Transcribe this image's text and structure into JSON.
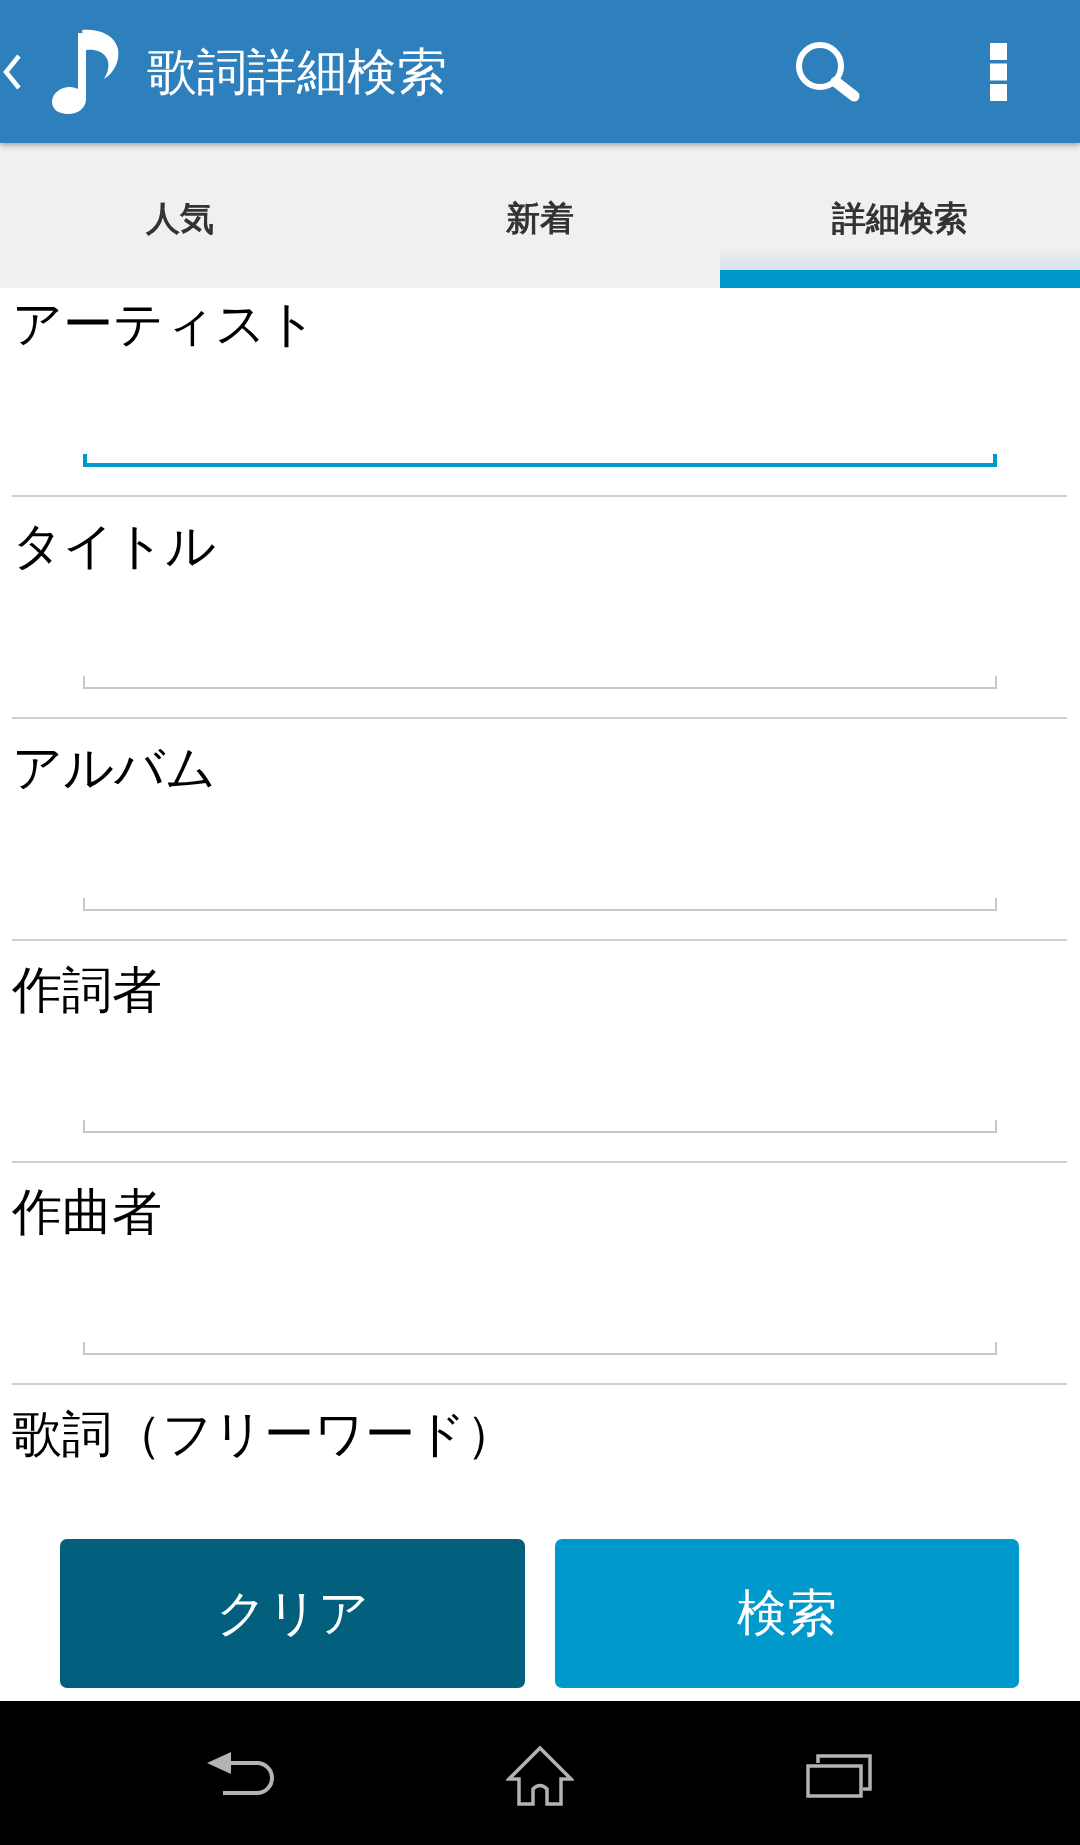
{
  "app_bar": {
    "title": "歌詞詳細検索"
  },
  "tabs": [
    {
      "label": "人気",
      "selected": false
    },
    {
      "label": "新着",
      "selected": false
    },
    {
      "label": "詳細検索",
      "selected": true
    }
  ],
  "form": {
    "fields": [
      {
        "label": "アーティスト",
        "focused": true
      },
      {
        "label": "タイトル",
        "focused": false
      },
      {
        "label": "アルバム",
        "focused": false
      },
      {
        "label": "作詞者",
        "focused": false
      },
      {
        "label": "作曲者",
        "focused": false
      }
    ],
    "cut_off_field": {
      "label": "歌詞（フリーワード）"
    }
  },
  "buttons": [
    {
      "label": "クリア",
      "kind": "clear"
    },
    {
      "label": "検索",
      "kind": "search"
    }
  ]
}
